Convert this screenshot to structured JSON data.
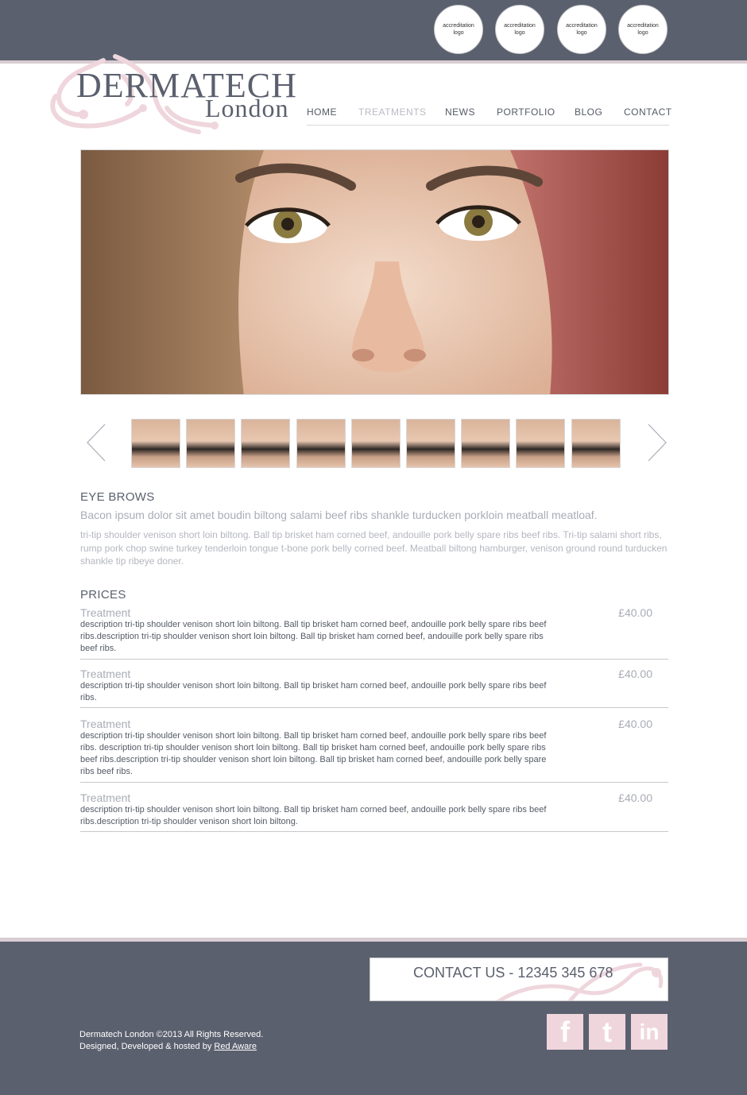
{
  "header": {
    "badges": [
      "accreditation logo",
      "accreditation logo",
      "accreditation logo",
      "accreditation logo"
    ],
    "logo": {
      "main": "DERMATECH",
      "sub": "London"
    },
    "nav": [
      {
        "label": "HOME",
        "active": false
      },
      {
        "label": "TREATMENTS",
        "active": true
      },
      {
        "label": "NEWS",
        "active": false
      },
      {
        "label": "PORTFOLIO",
        "active": false
      },
      {
        "label": "BLOG",
        "active": false
      },
      {
        "label": "CONTACT",
        "active": false
      }
    ]
  },
  "gallery": {
    "thumbnail_count": 9
  },
  "intro": {
    "title": "EYE BROWS",
    "lead": "Bacon ipsum dolor sit amet boudin biltong salami beef ribs shankle turducken porkloin meatball meatloaf.",
    "body": "tri-tip shoulder venison short loin biltong. Ball tip brisket ham corned beef, andouille pork belly spare ribs beef ribs. Tri-tip salami short ribs, rump pork chop swine turkey tenderloin tongue t-bone pork belly corned beef. Meatball biltong hamburger, venison ground round turducken shankle tip ribeye doner."
  },
  "prices": {
    "title": "PRICES",
    "items": [
      {
        "name": "Treatment",
        "price": "£40.00",
        "desc": "description tri-tip shoulder venison short loin biltong. Ball tip brisket ham corned beef, andouille pork belly spare ribs beef ribs.description tri-tip shoulder venison short loin biltong. Ball tip brisket ham corned beef, andouille pork belly spare ribs beef ribs."
      },
      {
        "name": "Treatment",
        "price": "£40.00",
        "desc": "description tri-tip shoulder venison short loin biltong. Ball tip brisket ham corned beef, andouille pork belly spare ribs beef ribs."
      },
      {
        "name": "Treatment",
        "price": "£40.00",
        "desc": "description tri-tip shoulder venison short loin biltong. Ball tip brisket ham corned beef, andouille pork belly spare ribs beef ribs. description tri-tip shoulder venison short loin biltong. Ball tip brisket ham corned beef, andouille pork belly spare ribs beef ribs.description tri-tip shoulder venison short loin biltong. Ball tip brisket ham corned beef, andouille pork belly spare ribs beef ribs."
      },
      {
        "name": "Treatment",
        "price": "£40.00",
        "desc": "description tri-tip shoulder venison short loin biltong. Ball tip brisket ham corned beef, andouille pork belly spare ribs beef ribs.description tri-tip shoulder venison short loin biltong."
      }
    ]
  },
  "footer": {
    "contact": "CONTACT US - 12345 345 678",
    "social": [
      {
        "icon": "facebook-icon",
        "glyph": "f"
      },
      {
        "icon": "twitter-icon",
        "glyph": "t"
      },
      {
        "icon": "linkedin-icon",
        "glyph": "in"
      }
    ],
    "copyright_line1": "Dermatech London ©2013 All Rights Reserved.",
    "copyright_line2_prefix": "Designed, Developed & hosted by ",
    "copyright_link": "Red Aware"
  },
  "colors": {
    "header_bg": "#5b606e",
    "accent_pink": "#efd6dd",
    "text_muted": "#a9acb5"
  }
}
